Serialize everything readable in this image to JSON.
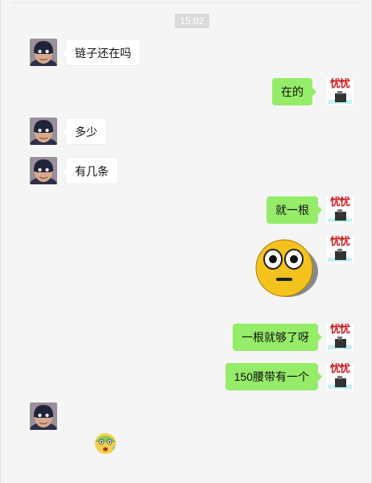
{
  "conversation": {
    "timestamp": "15:02",
    "messages": [
      {
        "side": "left",
        "type": "text",
        "text": "链子还在吗"
      },
      {
        "side": "right",
        "type": "text",
        "text": "在的"
      },
      {
        "side": "left",
        "type": "text",
        "text": "多少"
      },
      {
        "side": "left",
        "type": "text",
        "text": "有几条"
      },
      {
        "side": "right",
        "type": "text",
        "text": "就一根"
      },
      {
        "side": "right",
        "type": "sticker",
        "icon": "rolling-eyes-emoji-sticker"
      },
      {
        "side": "right",
        "type": "text",
        "text": "一根就够了呀"
      },
      {
        "side": "right",
        "type": "text",
        "text": "150腰带有一个"
      },
      {
        "side": "left",
        "type": "emoji",
        "icon": "sweat-face-emoji"
      }
    ]
  },
  "avatars": {
    "contact": {
      "icon": "masked-hero-avatar"
    },
    "self": {
      "icon": "youyou-text-avatar",
      "text": "忧忧"
    }
  },
  "colors": {
    "background": "#f5f5f5",
    "outgoing_bubble": "#95ec69",
    "incoming_bubble": "#ffffff",
    "avatar_text": "#d0161b"
  }
}
